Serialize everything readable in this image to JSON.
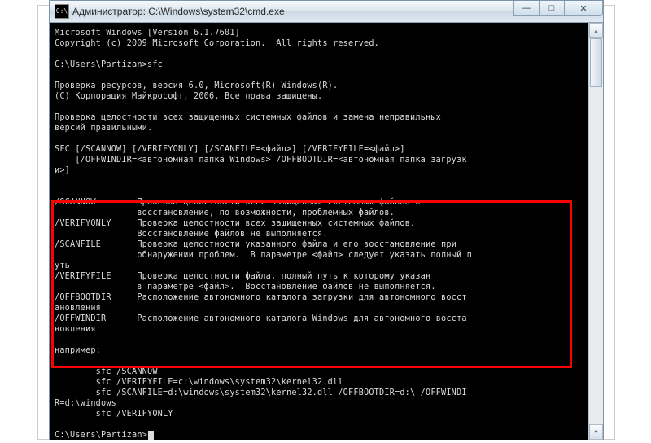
{
  "window": {
    "icon_text": "C:\\",
    "title": "Администратор: C:\\Windows\\system32\\cmd.exe"
  },
  "controls": {
    "min": "—",
    "max": "□",
    "close": "✕"
  },
  "scrollbar": {
    "up": "▴",
    "down": "▾"
  },
  "terminal": {
    "line01": "Microsoft Windows [Version 6.1.7601]",
    "line02": "Copyright (c) 2009 Microsoft Corporation.  All rights reserved.",
    "line03": "",
    "line04": "C:\\Users\\Partizan>sfc",
    "line05": "",
    "line06": "Проверка ресурсов, версия 6.0, Microsoft(R) Windows(R).",
    "line07": "(C) Корпорация Майкрософт, 2006. Все права защищены.",
    "line08": "",
    "line09": "Проверка целостности всех защищенных системных файлов и замена неправильных",
    "line10": "версий правильными.",
    "line11": "",
    "line12": "SFC [/SCANNOW] [/VERIFYONLY] [/SCANFILE=<файл>] [/VERIFYFILE=<файл>]",
    "line13": "    [/OFFWINDIR=<автономная папка Windows> /OFFBOOTDIR=<автономная папка загрузк",
    "line14": "и>]",
    "line15": "",
    "line16": "",
    "line17": "/SCANNOW        Проверка целостности всех защищенных системных файлов и",
    "line18": "                восстановление, по возможности, проблемных файлов.",
    "line19": "/VERIFYONLY     Проверка целостности всех защищенных системных файлов.",
    "line20": "                Восстановление файлов не выполняется.",
    "line21": "/SCANFILE       Проверка целостности указанного файла и его восстановление при",
    "line22": "                обнаружении проблем.  В параметре <файл> следует указать полный п",
    "line23": "уть",
    "line24": "/VERIFYFILE     Проверка целостности файла, полный путь к которому указан",
    "line25": "                в параметре <файл>.  Восстановление файлов не выполняется.",
    "line26": "/OFFBOOTDIR     Расположение автономного каталога загрузки для автономного восст",
    "line27": "ановления",
    "line28": "/OFFWINDIR      Расположение автономного каталога Windows для автономного восста",
    "line29": "новления",
    "line30": "",
    "line31": "например:",
    "line32": "",
    "line33": "        sfc /SCANNOW",
    "line34": "        sfc /VERIFYFILE=c:\\windows\\system32\\kernel32.dll",
    "line35": "        sfc /SCANFILE=d:\\windows\\system32\\kernel32.dll /OFFBOOTDIR=d:\\ /OFFWINDI",
    "line36": "R=d:\\windows",
    "line37": "        sfc /VERIFYONLY",
    "line38": "",
    "line39": "C:\\Users\\Partizan>"
  }
}
